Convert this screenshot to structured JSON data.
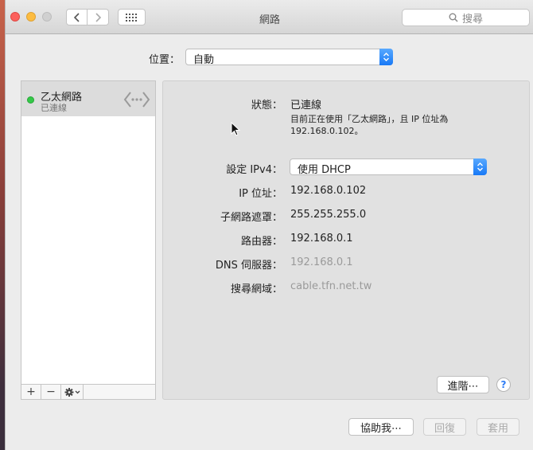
{
  "window": {
    "title": "網路"
  },
  "search": {
    "placeholder": "搜尋"
  },
  "location": {
    "label": "位置：",
    "value": "自動"
  },
  "sidebar": {
    "services": [
      {
        "name": "乙太網路",
        "status": "已連線",
        "status_color": "#34c848",
        "icon": "ethernet-arrows-icon"
      }
    ],
    "add_label": "+",
    "remove_label": "−"
  },
  "detail": {
    "status_label": "狀態：",
    "status_value": "已連線",
    "status_desc_line1": "目前正在使用「乙太網路」，且 IP 位址為",
    "status_desc_line2": "192.168.0.102。",
    "configure_label": "設定 IPv4：",
    "configure_value": "使用 DHCP",
    "ip_label": "IP 位址：",
    "ip_value": "192.168.0.102",
    "subnet_label": "子網路遮罩：",
    "subnet_value": "255.255.255.0",
    "router_label": "路由器：",
    "router_value": "192.168.0.1",
    "dns_label": "DNS 伺服器：",
    "dns_value": "192.168.0.1",
    "search_domain_label": "搜尋網域：",
    "search_domain_value": "cable.tfn.net.tw",
    "advanced_button": "進階⋯",
    "help_label": "?"
  },
  "footer": {
    "assist_button": "協助我⋯",
    "revert_button": "回復",
    "apply_button": "套用"
  },
  "colors": {
    "accent": "#1879f6",
    "connected": "#34c848"
  }
}
